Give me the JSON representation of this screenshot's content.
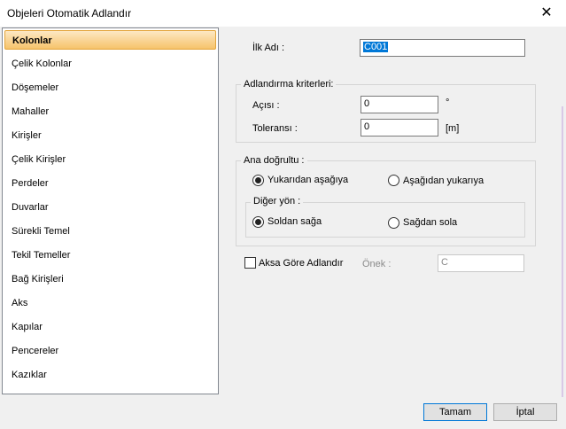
{
  "window": {
    "title": "Objeleri Otomatik Adlandır",
    "close_glyph": "✕"
  },
  "sidebar": {
    "items": [
      {
        "label": "Kolonlar",
        "selected": true
      },
      {
        "label": "Çelik Kolonlar"
      },
      {
        "label": "Döşemeler"
      },
      {
        "label": "Mahaller"
      },
      {
        "label": "Kirişler"
      },
      {
        "label": "Çelik Kirişler"
      },
      {
        "label": "Perdeler"
      },
      {
        "label": "Duvarlar"
      },
      {
        "label": "Sürekli Temel"
      },
      {
        "label": "Tekil Temeller"
      },
      {
        "label": "Bağ Kirişleri"
      },
      {
        "label": "Aks"
      },
      {
        "label": "Kapılar"
      },
      {
        "label": "Pencereler"
      },
      {
        "label": "Kazıklar"
      }
    ]
  },
  "form": {
    "first_name": {
      "label": "İlk Adı :",
      "value": "C001"
    },
    "criteria": {
      "title": "Adlandırma kriterleri:",
      "angle": {
        "label": "Açısı :",
        "value": "0",
        "unit": "°"
      },
      "tolerance": {
        "label": "Toleransı :",
        "value": "0",
        "unit": "[m]"
      }
    },
    "main_direction": {
      "title": "Ana doğrultu  :",
      "top_to_bottom": "Yukarıdan aşağıya",
      "bottom_to_top": "Aşağıdan yukarıya",
      "other": {
        "title": "Diğer yön  :",
        "left_to_right": "Soldan sağa",
        "right_to_left": "Sağdan sola"
      }
    },
    "axis_naming": {
      "label": "Aksa Göre Adlandır",
      "prefix_label": "Önek :",
      "prefix_value": "C",
      "checked": false
    }
  },
  "buttons": {
    "ok": "Tamam",
    "cancel": "İptal"
  }
}
